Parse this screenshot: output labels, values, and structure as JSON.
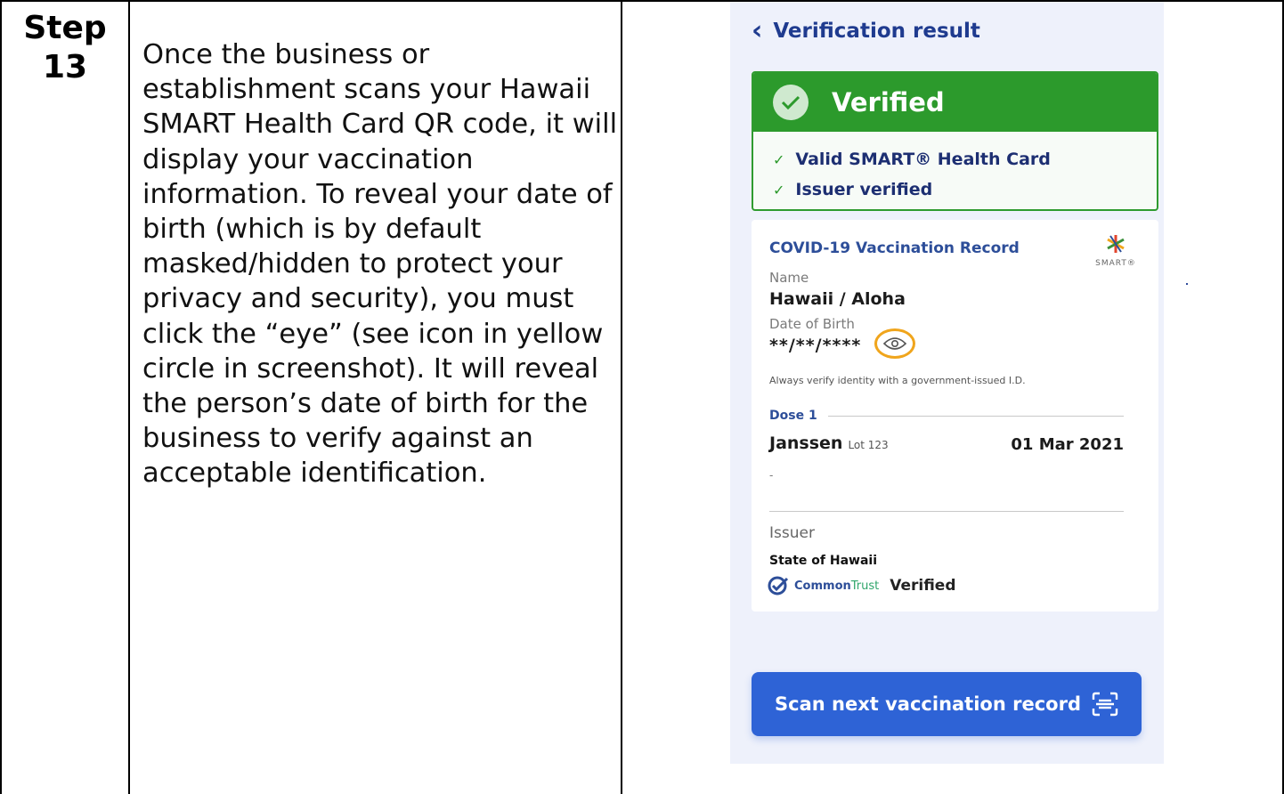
{
  "step": {
    "label": "Step",
    "number": "13"
  },
  "description": "Once the business or establishment scans your Hawaii SMART Health Card QR code, it will display your vaccination information.  To reveal your date of birth (which is by default masked/hidden to protect your privacy and security), you must click the “eye” (see icon in yellow circle in screenshot).  It will reveal the person’s date of birth for the business to verify against an acceptable identification.",
  "screenshot": {
    "header_title": "Verification result",
    "status": "Verified",
    "checks": [
      "Valid SMART® Health Card",
      "Issuer verified"
    ],
    "record": {
      "title": "COVID-19 Vaccination Record",
      "logo_text": "SMART®",
      "name_label": "Name",
      "name_value": "Hawaii / Aloha",
      "dob_label": "Date of Birth",
      "dob_value": "**/**/****",
      "id_note": "Always verify identity with a government-issued I.D.",
      "dose_label": "Dose 1",
      "vaccine": "Janssen",
      "lot": "Lot 123",
      "dose_date": "01 Mar 2021",
      "dose_extra": "-",
      "issuer_label": "Issuer",
      "issuer_value": "State of Hawaii",
      "trust_common": "Common",
      "trust_trust": "Trust",
      "trust_status": "Verified"
    },
    "scan_button": "Scan next vaccination record"
  },
  "colors": {
    "verified_green": "#2c9a2c",
    "primary_blue": "#2e63d6",
    "heading_navy": "#1f3b8f",
    "eye_highlight": "#f0a51c"
  }
}
